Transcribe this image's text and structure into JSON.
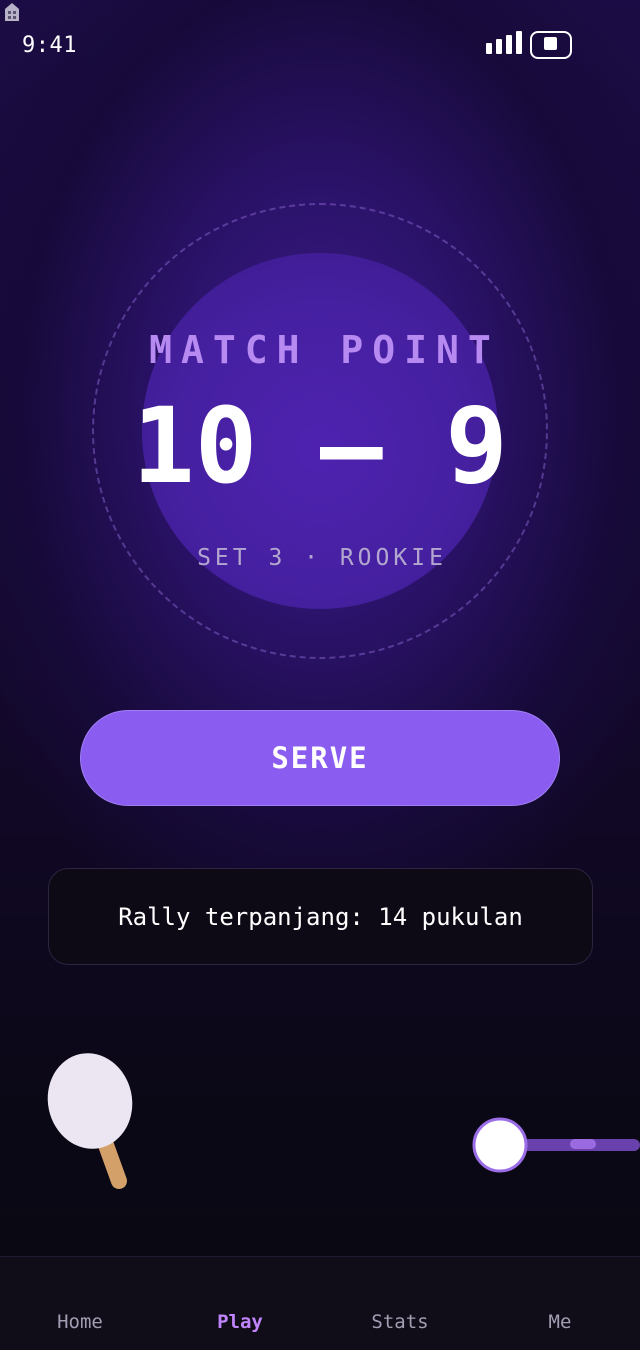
{
  "status_bar": {
    "time": "9:41"
  },
  "match": {
    "heading": "MATCH POINT",
    "score_left": "10",
    "score_separator": "—",
    "score_right": "9",
    "set_info": "SET 3 · ROOKIE"
  },
  "serve_button": {
    "label": "SERVE"
  },
  "rally": {
    "text": "Rally terpanjang: 14 pukulan"
  },
  "tabs": [
    {
      "label": "Home",
      "active": false
    },
    {
      "label": "Play",
      "active": true
    },
    {
      "label": "Stats",
      "active": false
    },
    {
      "label": "Me",
      "active": false
    }
  ],
  "colors": {
    "accent": "#8b5cf0",
    "heading": "#b78af2",
    "active_tab": "#c084fc",
    "background_top": "#1c0c45",
    "background_bottom": "#0a0a12"
  },
  "icons": [
    "lock-icon",
    "signal-icon",
    "battery-icon",
    "paddle-icon",
    "ball-icon"
  ]
}
